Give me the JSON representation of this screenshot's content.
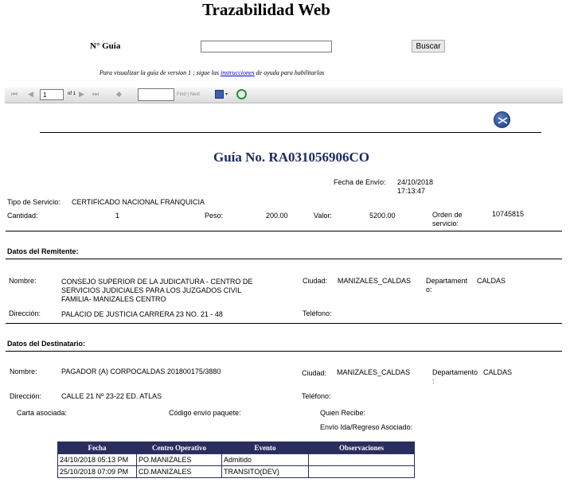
{
  "header": {
    "title": "Trazabilidad Web",
    "guia_label": "N° Guia",
    "guia_value": "",
    "search_label": "Buscar",
    "note_prefix": "Para visualizar la guía de version 1 ; sigue las ",
    "note_link": "instrucciones",
    "note_suffix": " de ayuda para habilitarlas"
  },
  "toolbar": {
    "page_value": "1",
    "page_of": "of 1",
    "find_label": "Find | Next",
    "icons": [
      "first-page-icon",
      "prev-page-icon",
      "next-page-icon",
      "last-page-icon",
      "back-icon",
      "export-icon",
      "refresh-icon"
    ]
  },
  "report": {
    "heading": "Guía No. RA031056906CO",
    "fecha_envio_label": "Fecha de Envío:",
    "fecha_envio_date": "24/10/2018",
    "fecha_envio_time": "17:13:47",
    "tipo_servicio_label": "Tipo de Servicio:",
    "tipo_servicio_value": "CERTIFICADO NACIONAL FRANQUICIA",
    "cantidad_label": "Cantidad:",
    "cantidad_value": "1",
    "peso_label": "Peso:",
    "peso_value": "200.00",
    "valor_label": "Valor:",
    "valor_value": "5200.00",
    "orden_label_1": "Orden de",
    "orden_label_2": "servicio:",
    "orden_value": "10745815"
  },
  "remitente": {
    "section_title": "Datos del Remitente:",
    "nombre_label": "Nombre:",
    "nombre_line1": "CONSEJO SUPERIOR DE LA JUDICATURA - CENTRO DE",
    "nombre_line2": "SERVICIOS JUDICIALES PARA LOS JUZGADOS CIVIL",
    "nombre_line3": "FAMILIA- MANIZALES CENTRO",
    "ciudad_label": "Ciudad:",
    "ciudad_value": "MANIZALES_CALDAS",
    "depto_label_1": "Departament",
    "depto_label_2": "o:",
    "depto_value": "CALDAS",
    "direccion_label": "Dirección:",
    "direccion_value": "PALACIO DE JUSTICIA CARRERA 23 NO. 21  - 48",
    "telefono_label": "Teléfono:"
  },
  "destinatario": {
    "section_title": "Datos del Destinatario:",
    "nombre_label": "Nombre:",
    "nombre_value": "PAGADOR (A) CORPOCALDAS 201800175/3880",
    "ciudad_label": "Ciudad:",
    "ciudad_value": "MANIZALES_CALDAS",
    "depto_label_1": "Departamento",
    "depto_label_2": ":",
    "depto_value": "CALDAS",
    "direccion_label": "Dirección:",
    "direccion_value": "CALLE 21 Nº 23-22 ED. ATLAS",
    "telefono_label": "Teléfono:",
    "carta_label": "Carta asociada:",
    "codigo_label": "Código envío paquete:",
    "quien_label": "Quien Recibe:",
    "envio_label": "Envío Ida/Regreso Asociado:"
  },
  "tracking": {
    "headers": [
      "Fecha",
      "Centro Operativo",
      "Evento",
      "Observaciones"
    ],
    "rows": [
      [
        "24/10/2018 05:13 PM",
        "PO.MANIZALES",
        "Admitido",
        ""
      ],
      [
        "25/10/2018 07:09 PM",
        "CD.MANIZALES",
        "TRANSITO(DEV)",
        ""
      ]
    ]
  }
}
